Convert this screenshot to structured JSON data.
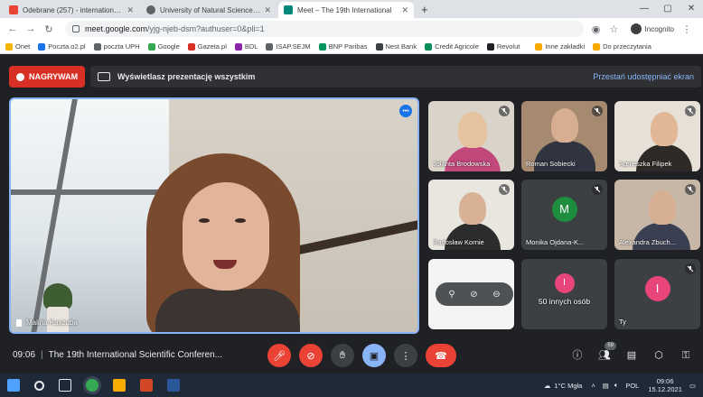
{
  "browser": {
    "tabs": [
      {
        "title": "Odebrane (257) - international.o",
        "favicon_color": "#ea4335",
        "active": false
      },
      {
        "title": "University of Natural Sciences an",
        "favicon_color": "#5f6368",
        "active": false
      },
      {
        "title": "Meet – The 19th International",
        "favicon_color": "#00897b",
        "active": true
      }
    ],
    "new_tab": "+",
    "url_host": "meet.google.com",
    "url_path": "/yjg-njeb-dsm?authuser=0&pli=1",
    "incognito_label": "Incognito",
    "bookmarks": [
      {
        "label": "Onet",
        "color": "#f4b400"
      },
      {
        "label": "Poczta.o2.pl",
        "color": "#1a73e8"
      },
      {
        "label": "poczta UPH",
        "color": "#5f6368"
      },
      {
        "label": "Google",
        "color": "#34a853"
      },
      {
        "label": "Gazeta.pl",
        "color": "#d93025"
      },
      {
        "label": "BDL",
        "color": "#8e24aa"
      },
      {
        "label": "ISAP.SEJM",
        "color": "#5f6368"
      },
      {
        "label": "BNP Paribas",
        "color": "#00965e"
      },
      {
        "label": "Nest Bank",
        "color": "#3c4043"
      },
      {
        "label": "Credit Agricole",
        "color": "#0a8f5a"
      },
      {
        "label": "Revolut",
        "color": "#202124"
      },
      {
        "label": "Inne zakładki",
        "color": "#f9ab00"
      },
      {
        "label": "Do przeczytania",
        "color": "#f9ab00"
      }
    ]
  },
  "meet": {
    "recording_label": "NAGRYWAM",
    "presentation_banner": "Wyświetlasz prezentację wszystkim",
    "stop_sharing": "Przestań udostępniać ekran",
    "main_speaker": "Malina Kaszuba",
    "participants": [
      {
        "name": "Jolanta Brodowska",
        "type": "video",
        "muted": true
      },
      {
        "name": "Roman Sobiecki",
        "type": "video",
        "muted": true
      },
      {
        "name": "Agnieszka Filipek",
        "type": "video",
        "muted": true
      },
      {
        "name": "Radosław Kornie",
        "type": "video",
        "muted": true
      },
      {
        "name": "Monika Ojdana-K...",
        "type": "avatar",
        "initial": "M",
        "avatar_color": "#1e8e3e",
        "muted": true
      },
      {
        "name": "Alexandra Zbuch...",
        "type": "video",
        "muted": true
      },
      {
        "name": "",
        "type": "video",
        "muted": false
      },
      {
        "name": "50 innych osób",
        "type": "others",
        "muted": false
      },
      {
        "name": "Ty",
        "type": "avatar",
        "initial": "I",
        "avatar_color": "#e8457a",
        "muted": true
      }
    ],
    "meeting_time": "09:06",
    "meeting_title": "The 19th International Scientific Conferen...",
    "participant_count": "59"
  },
  "taskbar": {
    "weather": "1°C  Mgła",
    "lang": "POL",
    "time": "09:06",
    "date": "15.12.2021"
  }
}
